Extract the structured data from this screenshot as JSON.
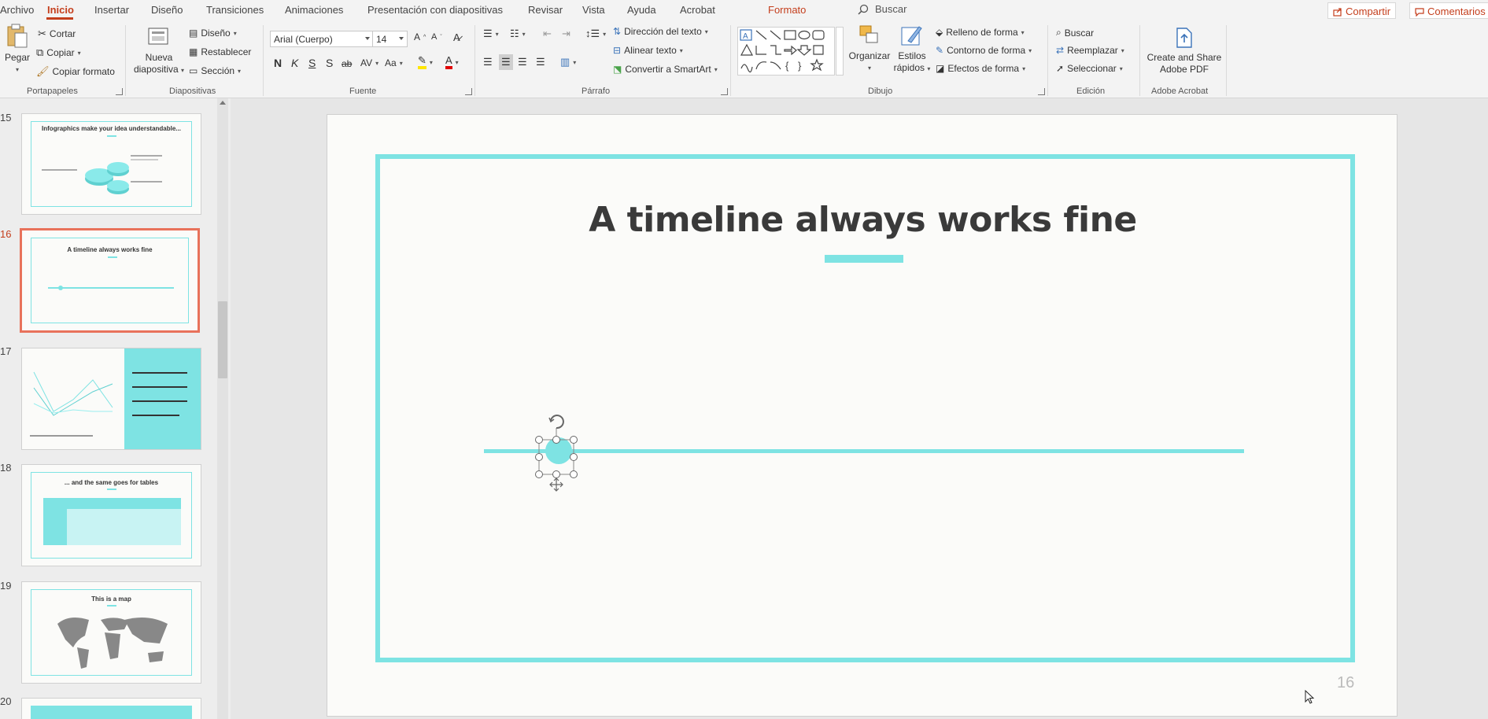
{
  "menu": {
    "items": [
      "Archivo",
      "Inicio",
      "Insertar",
      "Diseño",
      "Transiciones",
      "Animaciones",
      "Presentación con diapositivas",
      "Revisar",
      "Vista",
      "Ayuda",
      "Acrobat"
    ],
    "format_tab": "Formato",
    "search": "Buscar",
    "share": "Compartir",
    "comments": "Comentarios"
  },
  "ribbon": {
    "clipboard": {
      "paste": "Pegar",
      "cut": "Cortar",
      "copy": "Copiar",
      "format_painter": "Copiar formato",
      "label": "Portapapeles"
    },
    "slides": {
      "new_line1": "Nueva",
      "new_line2": "diapositiva",
      "layout": "Diseño",
      "reset": "Restablecer",
      "section": "Sección",
      "label": "Diapositivas"
    },
    "font": {
      "name": "Arial (Cuerpo)",
      "size": "14",
      "bold": "N",
      "italic": "K",
      "underline": "S",
      "shadow": "S",
      "strike": "ab",
      "label": "Fuente"
    },
    "paragraph": {
      "text_direction": "Dirección del texto",
      "align_text": "Alinear texto",
      "smartart": "Convertir a SmartArt",
      "label": "Párrafo"
    },
    "drawing": {
      "arrange": "Organizar",
      "quick_styles_line1": "Estilos",
      "quick_styles_line2": "rápidos",
      "fill": "Relleno de forma",
      "outline": "Contorno de forma",
      "effects": "Efectos de forma",
      "label": "Dibujo"
    },
    "editing": {
      "find": "Buscar",
      "replace": "Reemplazar",
      "select": "Seleccionar",
      "label": "Edición"
    },
    "acrobat": {
      "create_line1": "Create and Share",
      "create_line2": "Adobe PDF",
      "label": "Adobe Acrobat"
    }
  },
  "thumbnails": [
    {
      "num": "15",
      "title": "Infographics make your idea understandable..."
    },
    {
      "num": "16",
      "title": "A timeline always works fine"
    },
    {
      "num": "17",
      "title": ""
    },
    {
      "num": "18",
      "title": "... and the same goes for tables"
    },
    {
      "num": "19",
      "title": "This is a map"
    },
    {
      "num": "20",
      "title": ""
    }
  ],
  "slide": {
    "title": "A timeline always works fine",
    "number": "16"
  },
  "colors": {
    "accent": "#7ee3e3",
    "brand": "#c43e1c",
    "selection": "#e8725b"
  }
}
